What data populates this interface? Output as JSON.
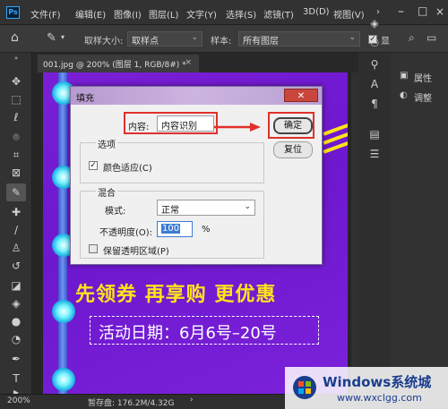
{
  "app": {
    "logo": "Ps"
  },
  "menubar": {
    "items": [
      "文件(F)",
      "编辑(E)",
      "图像(I)",
      "图层(L)",
      "文字(Y)",
      "选择(S)",
      "滤镜(T)",
      "3D(D)",
      "视图(V)"
    ]
  },
  "options": {
    "sample_size_label": "取样大小:",
    "sample_size_value": "取样点",
    "sample_label": "样本:",
    "sample_value": "所有图层",
    "show_ring_label": "显"
  },
  "document_tab": {
    "title": "001.jpg @ 200% (图层 1, RGB/8#) *",
    "close": "×"
  },
  "status": {
    "zoom": "200%",
    "scratch": "暂存盘: 176.2M/4.32G"
  },
  "panels": {
    "properties": "属性",
    "adjustments": "调整"
  },
  "artwork": {
    "headline": "先领券 再享购 更优惠",
    "date_line": "活动日期：6月6号–20号"
  },
  "dialog": {
    "title": "填充",
    "close": "✕",
    "content_label": "内容:",
    "content_value": "内容识别",
    "ok_button": "确定",
    "reset_button": "复位",
    "options_group": "选项",
    "color_adapt_label": "颜色适应(C)",
    "color_adapt_checked": true,
    "blend_group": "混合",
    "mode_label": "模式:",
    "mode_value": "正常",
    "opacity_label": "不透明度(O):",
    "opacity_value": "100",
    "opacity_unit": "%",
    "preserve_label": "保留透明区域(P)",
    "preserve_checked": false
  },
  "watermark": {
    "title": "Windows系统城",
    "url": "www.wxclgg.com"
  },
  "colors": {
    "highlight_red": "#e0302a",
    "banner_purple": "#7a1fd6",
    "headline_yellow": "#ffe31a",
    "ps_blue": "#31a8ff"
  }
}
